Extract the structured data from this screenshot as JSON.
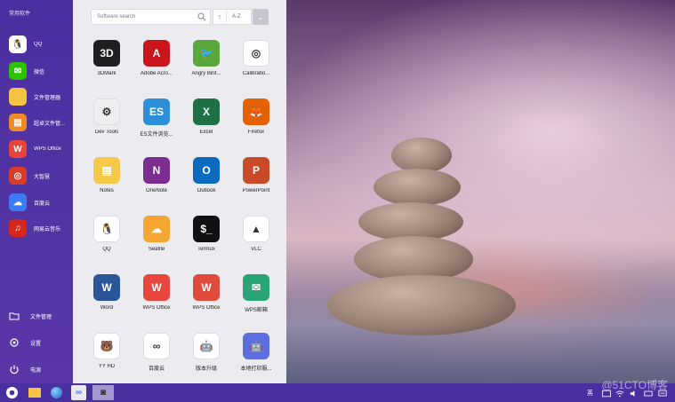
{
  "sidebar": {
    "title": "常用软件",
    "items": [
      {
        "label": "QQ",
        "icon": "qq-icon",
        "color": "#ffffff",
        "glyph": "🐧"
      },
      {
        "label": "微信",
        "icon": "wechat-icon",
        "color": "#2dc100",
        "glyph": "✉"
      },
      {
        "label": "文件管理器",
        "icon": "folder-icon",
        "color": "#f6c343",
        "glyph": ""
      },
      {
        "label": "超卓文件管...",
        "icon": "file-manager-icon",
        "color": "#f08a24",
        "glyph": "▤"
      },
      {
        "label": "WPS Office",
        "icon": "wps-icon",
        "color": "#e8453c",
        "glyph": "W"
      },
      {
        "label": "大智慧",
        "icon": "dazhihui-icon",
        "color": "#d93b2b",
        "glyph": "◎"
      },
      {
        "label": "百度云",
        "icon": "baidu-cloud-icon",
        "color": "#3b7cf5",
        "glyph": "☁"
      },
      {
        "label": "网易云音乐",
        "icon": "netease-music-icon",
        "color": "#d6251d",
        "glyph": "♫"
      }
    ],
    "bottom": [
      {
        "label": "文件管理",
        "icon": "folder-outline-icon"
      },
      {
        "label": "设置",
        "icon": "gear-icon"
      },
      {
        "label": "电源",
        "icon": "power-icon"
      }
    ]
  },
  "drawer": {
    "search_placeholder": "Software search",
    "sort_label": "A-Z",
    "apps": [
      {
        "label": "3DMark",
        "icon": "3dmark-icon",
        "color": "#1f1f1f",
        "glyph": "3D"
      },
      {
        "label": "Adobe Acro...",
        "icon": "adobe-acrobat-icon",
        "color": "#c9161d",
        "glyph": "A"
      },
      {
        "label": "Angry Bird...",
        "icon": "angry-birds-icon",
        "color": "#5aa83c",
        "glyph": "🐦"
      },
      {
        "label": "Calibratio...",
        "icon": "calibration-icon",
        "color": "#ffffff",
        "glyph": "◎"
      },
      {
        "label": "Dev Tools",
        "icon": "dev-tools-icon",
        "color": "#eeeeee",
        "glyph": "⚙"
      },
      {
        "label": "ES文件浏览...",
        "icon": "es-explorer-icon",
        "color": "#2d8fd9",
        "glyph": "ES"
      },
      {
        "label": "Excel",
        "icon": "excel-icon",
        "color": "#1e7145",
        "glyph": "X"
      },
      {
        "label": "Firefox",
        "icon": "firefox-icon",
        "color": "#e66000",
        "glyph": "🦊"
      },
      {
        "label": "Notes",
        "icon": "notes-icon",
        "color": "#f7c948",
        "glyph": "▤"
      },
      {
        "label": "OneNote",
        "icon": "onenote-icon",
        "color": "#7b2e8f",
        "glyph": "N"
      },
      {
        "label": "Outlook",
        "icon": "outlook-icon",
        "color": "#0a6bc0",
        "glyph": "O"
      },
      {
        "label": "PowerPoint",
        "icon": "powerpoint-icon",
        "color": "#c84a26",
        "glyph": "P"
      },
      {
        "label": "QQ",
        "icon": "qq-icon",
        "color": "#ffffff",
        "glyph": "🐧"
      },
      {
        "label": "Seafile",
        "icon": "seafile-icon",
        "color": "#f4a630",
        "glyph": "☁"
      },
      {
        "label": "Termux",
        "icon": "termux-icon",
        "color": "#111111",
        "glyph": "$_"
      },
      {
        "label": "VLC",
        "icon": "vlc-icon",
        "color": "#ffffff",
        "glyph": "▲"
      },
      {
        "label": "Word",
        "icon": "word-icon",
        "color": "#2a5699",
        "glyph": "W"
      },
      {
        "label": "WPS Office",
        "icon": "wps-office-icon",
        "color": "#e8453c",
        "glyph": "W"
      },
      {
        "label": "WPS Office",
        "icon": "wps-office-pro-icon",
        "color": "#e04a3a",
        "glyph": "W"
      },
      {
        "label": "WPS邮箱",
        "icon": "wps-mail-icon",
        "color": "#2aa676",
        "glyph": "✉"
      },
      {
        "label": "YY HD",
        "icon": "yy-hd-icon",
        "color": "#ffffff",
        "glyph": "🐻"
      },
      {
        "label": "百度云",
        "icon": "baidu-cloud-icon",
        "color": "#ffffff",
        "glyph": "∞"
      },
      {
        "label": "版本升级",
        "icon": "android-upgrade-icon",
        "color": "#ffffff",
        "glyph": "🤖"
      },
      {
        "label": "本地打印服...",
        "icon": "print-service-icon",
        "color": "#5b6fe0",
        "glyph": "🤖"
      }
    ]
  },
  "taskbar": {
    "ime": "英",
    "watermark": "@51CTO博客"
  },
  "colors": {
    "sidebar_bg": "#4a2fa0",
    "drawer_bg": "#ecebf0",
    "taskbar_bg": "#4a2fa0"
  }
}
